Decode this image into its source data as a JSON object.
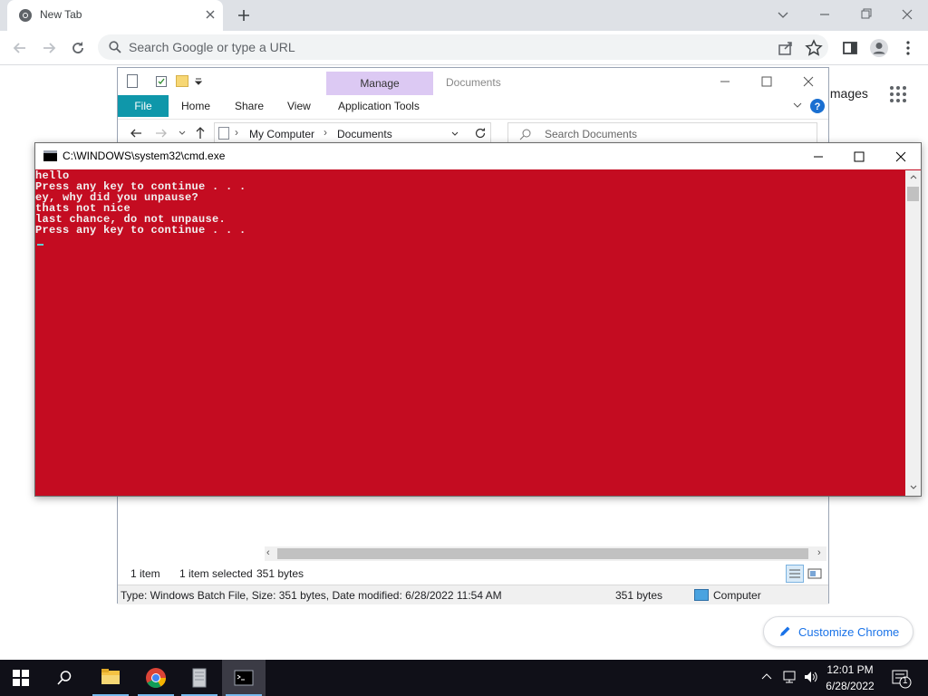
{
  "chrome": {
    "tab_title": "New Tab",
    "omnibox_placeholder": "Search Google or type a URL",
    "images_link": "Images",
    "customize_label": "Customize Chrome"
  },
  "explorer": {
    "manage_label": "Manage",
    "title": "Documents",
    "tabs": {
      "file": "File",
      "home": "Home",
      "share": "Share",
      "view": "View",
      "app_tools": "Application Tools"
    },
    "breadcrumb": [
      "My Computer",
      "Documents"
    ],
    "search_placeholder": "Search Documents",
    "status": {
      "items": "1 item",
      "selected": "1 item selected",
      "size": "351 bytes"
    },
    "details": {
      "type_info": "Type: Windows Batch File, Size: 351 bytes, Date modified: 6/28/2022 11:54 AM",
      "size": "351 bytes",
      "location": "Computer"
    }
  },
  "cmd": {
    "title": "C:\\WINDOWS\\system32\\cmd.exe",
    "lines": [
      "hello",
      "Press any key to continue . . .",
      "ey, why did you unpause?",
      "thats not nice",
      "last chance, do not unpause.",
      "Press any key to continue . . ."
    ],
    "background_color": "#c40c21",
    "text_color": "#f2f2f2"
  },
  "taskbar": {
    "apps": [
      "file-explorer",
      "chrome",
      "recycle-bin",
      "cmd"
    ],
    "time": "12:01 PM",
    "date": "6/28/2022",
    "notification_count": "1"
  }
}
